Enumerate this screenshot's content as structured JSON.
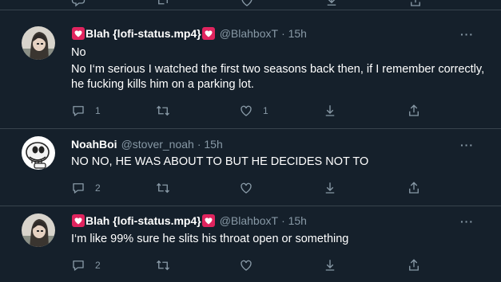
{
  "tweets": [
    {
      "display_name": "Blah {lofi-status.mp4}",
      "handle": "@BlahboxT",
      "time": "· 15h",
      "lines": [
        "No",
        "No I‘m serious I watched the first two seasons back then, if I remember correctly, he fucking kills him on a parking lot."
      ],
      "reply_count": "1",
      "retweet_count": "",
      "like_count": "1"
    },
    {
      "display_name": "NoahBoi",
      "handle": "@stover_noah",
      "time": "· 15h",
      "lines": [
        "NO NO, HE WAS ABOUT TO BUT HE DECIDES NOT TO"
      ],
      "reply_count": "2",
      "retweet_count": "",
      "like_count": ""
    },
    {
      "display_name": "Blah {lofi-status.mp4}",
      "handle": "@BlahboxT",
      "time": "· 15h",
      "lines": [
        "I‘m like 99% sure he slits his throat open or something"
      ],
      "reply_count": "2",
      "retweet_count": "",
      "like_count": ""
    }
  ],
  "more_label": "···",
  "colors": {
    "bg": "#15202b",
    "secondary": "#8899a6",
    "divider": "#38444d",
    "heart": "#e0245e"
  },
  "icons": [
    "reply-icon",
    "retweet-icon",
    "like-icon",
    "share-icon",
    "upload-icon",
    "more-icon",
    "heart-emoji-icon"
  ]
}
